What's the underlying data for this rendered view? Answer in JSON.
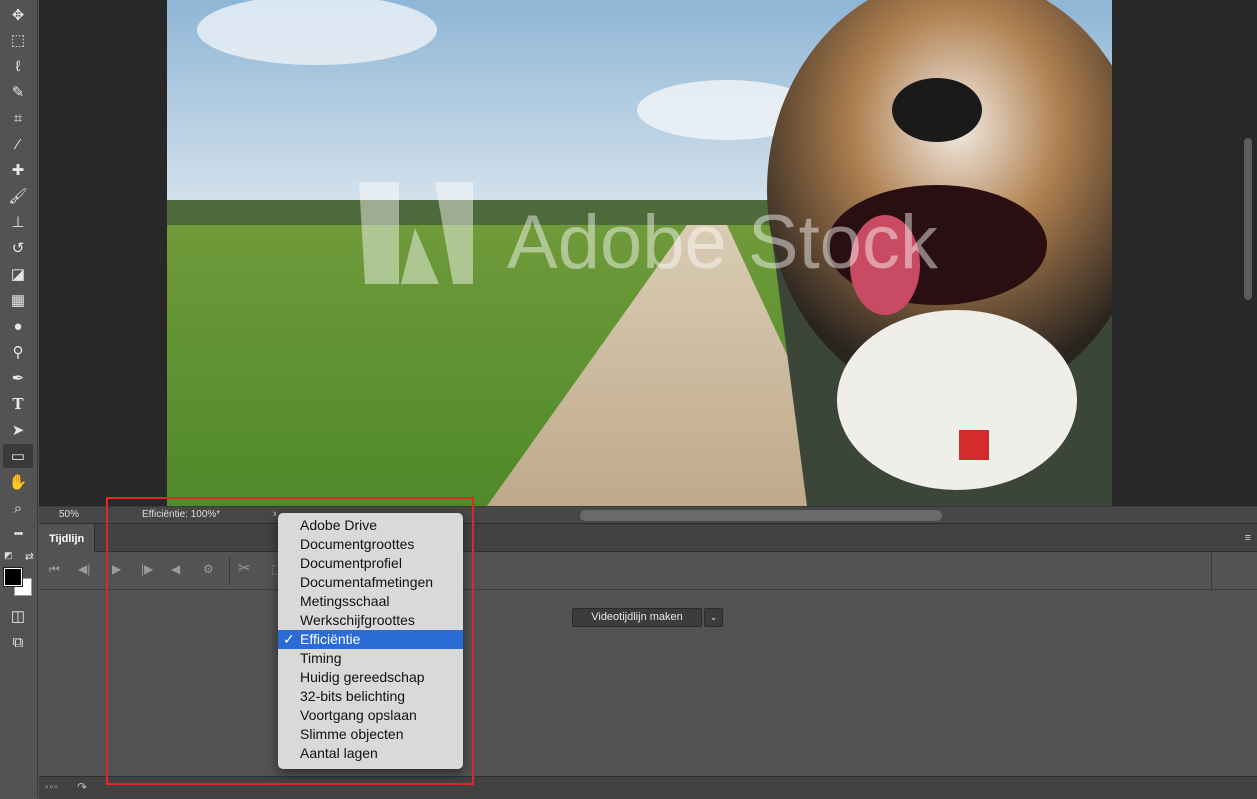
{
  "toolbar": {
    "tools": [
      {
        "name": "move-tool",
        "glyph": "✥"
      },
      {
        "name": "marquee-tool",
        "glyph": "⬚"
      },
      {
        "name": "lasso-tool",
        "glyph": "ℓ"
      },
      {
        "name": "quick-selection-tool",
        "glyph": "✎"
      },
      {
        "name": "crop-tool",
        "glyph": "⌗"
      },
      {
        "name": "eyedropper-tool",
        "glyph": "⁄"
      },
      {
        "name": "healing-brush-tool",
        "glyph": "✚"
      },
      {
        "name": "brush-tool",
        "glyph": "🖌"
      },
      {
        "name": "clone-stamp-tool",
        "glyph": "⊥"
      },
      {
        "name": "history-brush-tool",
        "glyph": "↺"
      },
      {
        "name": "eraser-tool",
        "glyph": "◪"
      },
      {
        "name": "gradient-tool",
        "glyph": "▦"
      },
      {
        "name": "blur-tool",
        "glyph": "●"
      },
      {
        "name": "dodge-tool",
        "glyph": "⚲"
      },
      {
        "name": "pen-tool",
        "glyph": "✒"
      },
      {
        "name": "type-tool",
        "glyph": "T"
      },
      {
        "name": "path-selection-tool",
        "glyph": "➤"
      },
      {
        "name": "rectangle-tool",
        "glyph": "▭",
        "active": true
      },
      {
        "name": "hand-tool",
        "glyph": "✋"
      },
      {
        "name": "zoom-tool",
        "glyph": "⌕"
      },
      {
        "name": "more-tools",
        "glyph": "•••"
      }
    ],
    "swatches": {
      "swap_glyph": "⇄",
      "default_glyph": "◩",
      "foreground": "#000000",
      "background": "#ffffff"
    },
    "bottom_tools": [
      {
        "name": "quick-mask-tool",
        "glyph": "◫"
      },
      {
        "name": "screen-mode-tool",
        "glyph": "⧉"
      }
    ]
  },
  "canvas": {
    "watermark": "Adobe Stock"
  },
  "status_bar": {
    "zoom": "50%",
    "efficiency": "Efficiëntie: 100%*",
    "arrow": "›"
  },
  "timeline": {
    "tab_label": "Tijdlijn",
    "menu_glyph": "≡",
    "controls": {
      "first_frame": "⏮",
      "prev_frame": "◀|",
      "play": "▶",
      "next_frame": "|▶",
      "audio": "◀",
      "settings": "⚙",
      "split": "✂",
      "transition": "⬚"
    },
    "create_button": "Videotijdlijn maken",
    "create_dropdown": "⌄",
    "footer_icons": "▫▫▫",
    "footer_share": "↷"
  },
  "popup_menu": {
    "items": [
      {
        "label": "Adobe Drive",
        "selected": false
      },
      {
        "label": "Documentgroottes",
        "selected": false
      },
      {
        "label": "Documentprofiel",
        "selected": false
      },
      {
        "label": "Documentafmetingen",
        "selected": false
      },
      {
        "label": "Metingsschaal",
        "selected": false
      },
      {
        "label": "Werkschijfgroottes",
        "selected": false
      },
      {
        "label": "Efficiëntie",
        "selected": true
      },
      {
        "label": "Timing",
        "selected": false
      },
      {
        "label": "Huidig gereedschap",
        "selected": false
      },
      {
        "label": "32-bits belichting",
        "selected": false
      },
      {
        "label": "Voortgang opslaan",
        "selected": false
      },
      {
        "label": "Slimme objecten",
        "selected": false
      },
      {
        "label": "Aantal lagen",
        "selected": false
      }
    ],
    "check_glyph": "✓"
  }
}
